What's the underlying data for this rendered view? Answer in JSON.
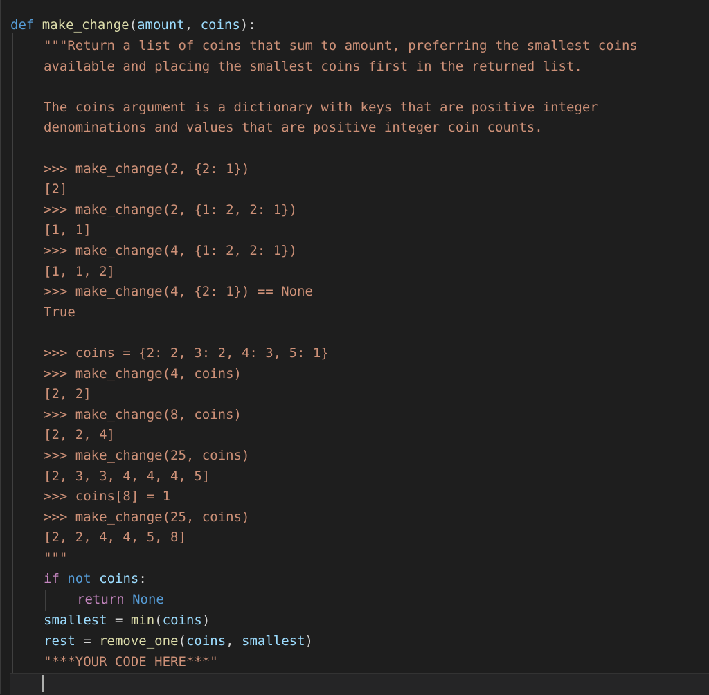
{
  "code": {
    "sig_def": "def",
    "sig_name": "make_change",
    "sig_open": "(",
    "sig_param1": "amount",
    "sig_comma": ", ",
    "sig_param2": "coins",
    "sig_close": "):",
    "doc": [
      "\"\"\"Return a list of coins that sum to amount, preferring the smallest coins",
      "available and placing the smallest coins first in the returned list.",
      "",
      "The coins argument is a dictionary with keys that are positive integer",
      "denominations and values that are positive integer coin counts.",
      "",
      ">>> make_change(2, {2: 1})",
      "[2]",
      ">>> make_change(2, {1: 2, 2: 1})",
      "[1, 1]",
      ">>> make_change(4, {1: 2, 2: 1})",
      "[1, 1, 2]",
      ">>> make_change(4, {2: 1}) == None",
      "True",
      "",
      ">>> coins = {2: 2, 3: 2, 4: 3, 5: 1}",
      ">>> make_change(4, coins)",
      "[2, 2]",
      ">>> make_change(8, coins)",
      "[2, 2, 4]",
      ">>> make_change(25, coins)",
      "[2, 3, 3, 4, 4, 4, 5]",
      ">>> coins[8] = 1",
      ">>> make_change(25, coins)",
      "[2, 2, 4, 4, 5, 8]",
      "\"\"\""
    ],
    "if_kw": "if",
    "not_kw": "not",
    "if_var": "coins",
    "if_colon": ":",
    "return_kw": "return",
    "none_kw": "None",
    "smallest_var": "smallest",
    "smallest_eq": " = ",
    "min_fn": "min",
    "min_open": "(",
    "min_arg": "coins",
    "min_close": ")",
    "rest_var": "rest",
    "rest_eq": " = ",
    "remove_fn": "remove_one",
    "remove_open": "(",
    "remove_arg1": "coins",
    "remove_comma": ", ",
    "remove_arg2": "smallest",
    "remove_close": ")",
    "placeholder": "\"***YOUR CODE HERE***\""
  },
  "colors": {
    "background": "#1e1e1e",
    "keyword": "#569cd6",
    "control": "#c586c0",
    "function": "#dcdcaa",
    "parameter": "#9cdcfe",
    "string": "#ce9178"
  }
}
